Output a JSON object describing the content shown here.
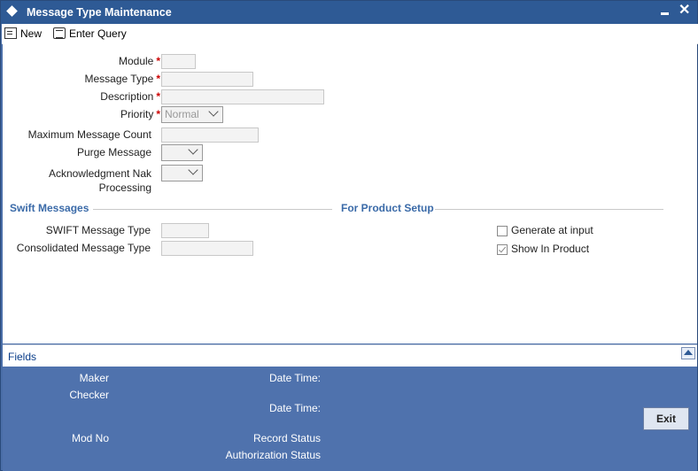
{
  "window": {
    "title": "Message Type Maintenance"
  },
  "toolbar": {
    "new_label": "New",
    "enter_query_label": "Enter Query"
  },
  "form": {
    "module_label": "Module",
    "message_type_label": "Message Type",
    "description_label": "Description",
    "priority_label": "Priority",
    "priority_value": "Normal",
    "max_message_count_label": "Maximum Message Count",
    "purge_message_label": "Purge Message",
    "ack_nak_label_line1": "Acknowledgment Nak",
    "ack_nak_label_line2": "Processing",
    "required_marker": "*"
  },
  "swift_section": {
    "title": "Swift Messages",
    "swift_message_type_label": "SWIFT Message Type",
    "consolidated_message_type_label": "Consolidated Message Type"
  },
  "product_section": {
    "title": "For Product Setup",
    "generate_at_input_label": "Generate at input",
    "generate_at_input_checked": false,
    "show_in_product_label": "Show In Product",
    "show_in_product_checked": true
  },
  "fields_bar": {
    "label": "Fields"
  },
  "footer": {
    "maker_label": "Maker",
    "checker_label": "Checker",
    "date_time_label": "Date Time:",
    "mod_no_label": "Mod No",
    "record_status_label": "Record Status",
    "authorization_status_label": "Authorization Status",
    "exit_label": "Exit"
  }
}
